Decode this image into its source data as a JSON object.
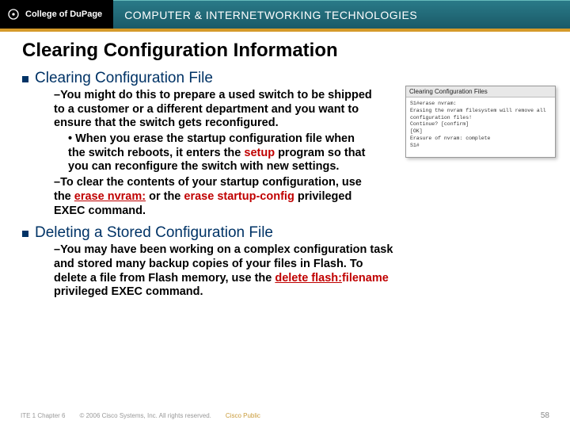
{
  "header": {
    "college": "College of DuPage",
    "right": "COMPUTER & INTERNETWORKING TECHNOLOGIES"
  },
  "title": "Clearing Configuration Information",
  "sections": [
    {
      "heading": "Clearing Configuration File",
      "items": [
        {
          "type": "dash",
          "runs": [
            {
              "t": "–You might do this to prepare a used switch to be shipped to a customer or a different department and you want to ensure that the switch gets reconfigured."
            }
          ]
        },
        {
          "type": "dot",
          "runs": [
            {
              "t": "• When you erase the startup configuration file when the switch reboots, it enters the "
            },
            {
              "t": "setup",
              "hl": true
            },
            {
              "t": " program so that you can reconfigure the switch with new settings."
            }
          ]
        },
        {
          "type": "dash",
          "runs": [
            {
              "t": "–To clear the contents of your startup configuration, use the "
            },
            {
              "t": "erase nvram:",
              "hl": true,
              "u": true
            },
            {
              "t": " or the "
            },
            {
              "t": "erase startup-config",
              "hl": true
            },
            {
              "t": " privileged EXEC command."
            }
          ]
        }
      ]
    },
    {
      "heading": "Deleting a Stored Configuration File",
      "items": [
        {
          "type": "dash",
          "wide": true,
          "runs": [
            {
              "t": "–You may have been working on a complex configuration task and stored many backup copies of your files in Flash. To delete a file from Flash memory, use the "
            },
            {
              "t": "delete flash:",
              "hl": true,
              "u": true
            },
            {
              "t": "filename",
              "hl": true
            },
            {
              "t": " privileged EXEC command."
            }
          ]
        }
      ]
    }
  ],
  "inset": {
    "title": "Clearing Configuration Files",
    "body": "S1#erase nvram:\nErasing the nvram filesystem will remove all configuration files!\nContinue? [confirm]\n[OK]\nErasure of nvram: complete\nS1#"
  },
  "footer": {
    "left": "ITE 1 Chapter 6",
    "center": "© 2006 Cisco Systems, Inc. All rights reserved.",
    "accent": "Cisco Public",
    "page": "58"
  }
}
